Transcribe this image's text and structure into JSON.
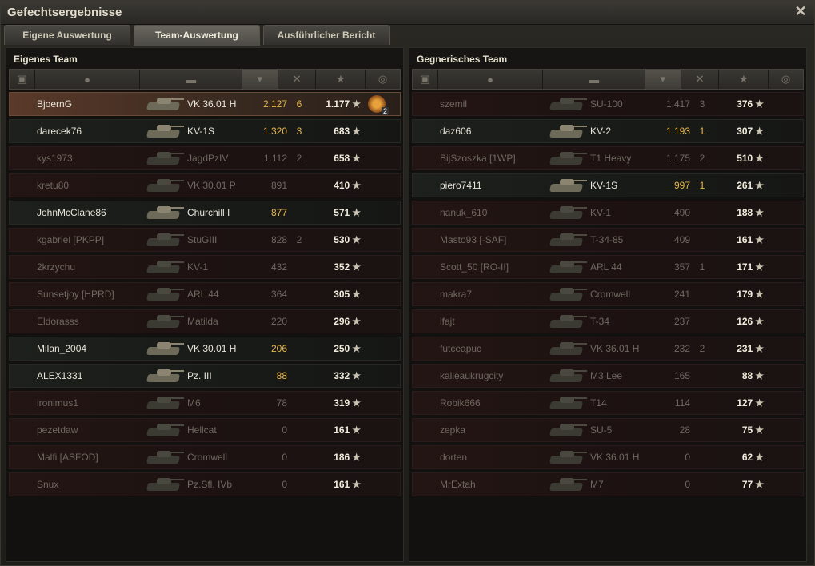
{
  "window": {
    "title": "Gefechtsergebnisse",
    "close_glyph": "✕"
  },
  "tabs": [
    {
      "label": "Eigene Auswertung",
      "active": false
    },
    {
      "label": "Team-Auswertung",
      "active": true
    },
    {
      "label": "Ausführlicher Bericht",
      "active": false
    }
  ],
  "own_team": {
    "title": "Eigenes Team",
    "rows": [
      {
        "name": "BjoernG",
        "tank": "VK 36.01 H",
        "damage": "2.127",
        "kills": "6",
        "xp": "1.177",
        "state": "me",
        "medal": "2"
      },
      {
        "name": "darecek76",
        "tank": "KV-1S",
        "damage": "1.320",
        "kills": "3",
        "xp": "683",
        "state": "alive"
      },
      {
        "name": "kys1973",
        "tank": "JagdPzIV",
        "damage": "1.112",
        "kills": "2",
        "xp": "658",
        "state": "dead"
      },
      {
        "name": "kretu80",
        "tank": "VK 30.01 P",
        "damage": "891",
        "kills": "",
        "xp": "410",
        "state": "dead"
      },
      {
        "name": "JohnMcClane86",
        "tank": "Churchill I",
        "damage": "877",
        "kills": "",
        "xp": "571",
        "state": "alive"
      },
      {
        "name": "kgabriel [PKPP]",
        "tank": "StuGIII",
        "damage": "828",
        "kills": "2",
        "xp": "530",
        "state": "dead"
      },
      {
        "name": "2krzychu",
        "tank": "KV-1",
        "damage": "432",
        "kills": "",
        "xp": "352",
        "state": "dead"
      },
      {
        "name": "Sunsetjoy [HPRD]",
        "tank": "ARL 44",
        "damage": "364",
        "kills": "",
        "xp": "305",
        "state": "dead"
      },
      {
        "name": "Eldorasss",
        "tank": "Matilda",
        "damage": "220",
        "kills": "",
        "xp": "296",
        "state": "dead"
      },
      {
        "name": "Milan_2004",
        "tank": "VK 30.01 H",
        "damage": "206",
        "kills": "",
        "xp": "250",
        "state": "alive"
      },
      {
        "name": "ALEX1331",
        "tank": "Pz. III",
        "damage": "88",
        "kills": "",
        "xp": "332",
        "state": "alive"
      },
      {
        "name": "ironimus1",
        "tank": "M6",
        "damage": "78",
        "kills": "",
        "xp": "319",
        "state": "dead"
      },
      {
        "name": "pezetdaw",
        "tank": "Hellcat",
        "damage": "0",
        "kills": "",
        "xp": "161",
        "state": "dead"
      },
      {
        "name": "Malfi [ASFOD]",
        "tank": "Cromwell",
        "damage": "0",
        "kills": "",
        "xp": "186",
        "state": "dead"
      },
      {
        "name": "Snux",
        "tank": "Pz.Sfl. IVb",
        "damage": "0",
        "kills": "",
        "xp": "161",
        "state": "dead"
      }
    ]
  },
  "enemy_team": {
    "title": "Gegnerisches Team",
    "rows": [
      {
        "name": "szemil",
        "tank": "SU-100",
        "damage": "1.417",
        "kills": "3",
        "xp": "376",
        "state": "dead"
      },
      {
        "name": "daz606",
        "tank": "KV-2",
        "damage": "1.193",
        "kills": "1",
        "xp": "307",
        "state": "alive"
      },
      {
        "name": "BijSzoszka [1WP]",
        "tank": "T1 Heavy",
        "damage": "1.175",
        "kills": "2",
        "xp": "510",
        "state": "dead"
      },
      {
        "name": "piero7411",
        "tank": "KV-1S",
        "damage": "997",
        "kills": "1",
        "xp": "261",
        "state": "alive"
      },
      {
        "name": "nanuk_610",
        "tank": "KV-1",
        "damage": "490",
        "kills": "",
        "xp": "188",
        "state": "dead"
      },
      {
        "name": "Masto93 [-SAF]",
        "tank": "T-34-85",
        "damage": "409",
        "kills": "",
        "xp": "161",
        "state": "dead"
      },
      {
        "name": "Scott_50 [RO-II]",
        "tank": "ARL 44",
        "damage": "357",
        "kills": "1",
        "xp": "171",
        "state": "dead"
      },
      {
        "name": "makra7",
        "tank": "Cromwell",
        "damage": "241",
        "kills": "",
        "xp": "179",
        "state": "dead"
      },
      {
        "name": "ifajt",
        "tank": "T-34",
        "damage": "237",
        "kills": "",
        "xp": "126",
        "state": "dead"
      },
      {
        "name": "futceapuc",
        "tank": "VK 36.01 H",
        "damage": "232",
        "kills": "2",
        "xp": "231",
        "state": "dead"
      },
      {
        "name": "kalleaukrugcity",
        "tank": "M3 Lee",
        "damage": "165",
        "kills": "",
        "xp": "88",
        "state": "dead"
      },
      {
        "name": "Robik666",
        "tank": "T14",
        "damage": "114",
        "kills": "",
        "xp": "127",
        "state": "dead"
      },
      {
        "name": "zepka",
        "tank": "SU-5",
        "damage": "28",
        "kills": "",
        "xp": "75",
        "state": "dead"
      },
      {
        "name": "dorten",
        "tank": "VK 36.01 H",
        "damage": "0",
        "kills": "",
        "xp": "62",
        "state": "dead"
      },
      {
        "name": "MrExtah",
        "tank": "M7",
        "damage": "0",
        "kills": "",
        "xp": "77",
        "state": "dead"
      }
    ]
  },
  "icons": {
    "header": [
      "platoon-icon",
      "player-icon",
      "tank-icon",
      "damage-sort-icon",
      "kills-icon",
      "xp-star-icon",
      "medal-icon"
    ],
    "star_glyph": "★"
  },
  "colors": {
    "damage_highlight": "#e8b84a",
    "own_row": "#5a3a2a",
    "dead_row": "#231513",
    "alive_row": "#1d201c"
  }
}
